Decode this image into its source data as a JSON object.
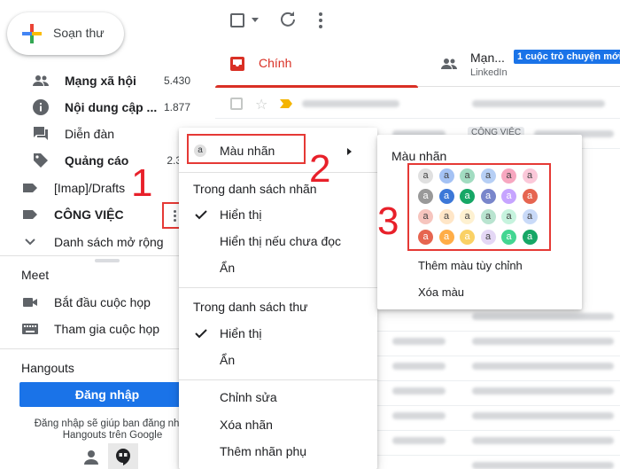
{
  "compose": {
    "label": "Soạn thư"
  },
  "sidebar": {
    "items": [
      {
        "label": "Mạng xã hội",
        "count": "5.430",
        "icon": "people-icon",
        "bold": true
      },
      {
        "label": "Nội dung cập ...",
        "count": "1.877",
        "icon": "info-icon",
        "bold": true
      },
      {
        "label": "Diễn đàn",
        "count": "",
        "icon": "forum-icon",
        "bold": false
      },
      {
        "label": "Quảng cáo",
        "count": "2.3",
        "icon": "tag-icon",
        "bold": true
      },
      {
        "label": "[Imap]/Drafts",
        "count": "",
        "icon": "label-icon",
        "bold": false
      },
      {
        "label": "CÔNG VIỆC",
        "count": "",
        "icon": "label-icon",
        "bold": true
      },
      {
        "label": "Danh sách mở rộng",
        "count": "",
        "icon": "chevron-down-icon",
        "bold": false
      }
    ],
    "meet": {
      "title": "Meet",
      "start": "Bắt đầu cuộc họp",
      "join": "Tham gia cuộc họp"
    },
    "hangouts": {
      "title": "Hangouts",
      "signin": "Đăng nhập",
      "hint": "Đăng nhập sẽ giúp ban đăng nhập Hangouts trên Google"
    }
  },
  "tabs": {
    "primary": "Chính",
    "social": "Mạn...",
    "social_sub": "LinkedIn",
    "social_badge": "1 cuộc trò chuyện mới"
  },
  "mail_rows": {
    "chip": "CÔNG VIỆC"
  },
  "context_menu": {
    "label_color": "Màu nhãn",
    "label_letter": "a",
    "section_label_list": "Trong danh sách nhãn",
    "show": "Hiển thị",
    "show_if_unread": "Hiển thị nếu chưa đọc",
    "hide": "Ẩn",
    "section_message_list": "Trong danh sách thư",
    "show2": "Hiển thị",
    "hide2": "Ẩn",
    "edit": "Chỉnh sửa",
    "remove_label": "Xóa nhãn",
    "add_sublabel": "Thêm nhãn phụ"
  },
  "color_menu": {
    "title": "Màu nhãn",
    "add_custom": "Thêm màu tùy chỉnh",
    "remove_color": "Xóa màu",
    "swatch_letter": "a",
    "swatches": [
      [
        "#e0e0e0",
        "#a4c2f4",
        "#a2dcc1",
        "#b6cff5",
        "#f7a7c0",
        "#fbc8d9"
      ],
      [
        "#999999",
        "#3c78d8",
        "#16a766",
        "#7986cb",
        "#c6a4ff",
        "#e66550"
      ],
      [
        "#f6c5be",
        "#ffe6c7",
        "#fef1d1",
        "#b9e4d0",
        "#c6f3de",
        "#c9daf8"
      ],
      [
        "#e66550",
        "#ffad47",
        "#fad165",
        "#e4d7f5",
        "#43d692",
        "#16a766"
      ]
    ],
    "swatch_text": [
      [
        "#444444",
        "#444444",
        "#444444",
        "#444444",
        "#444444",
        "#444444"
      ],
      [
        "#ffffff",
        "#ffffff",
        "#ffffff",
        "#ffffff",
        "#ffffff",
        "#ffffff"
      ],
      [
        "#444444",
        "#444444",
        "#444444",
        "#444444",
        "#444444",
        "#444444"
      ],
      [
        "#ffffff",
        "#ffffff",
        "#ffffff",
        "#444444",
        "#ffffff",
        "#ffffff"
      ]
    ]
  },
  "annotations": {
    "step1": "1",
    "step2": "2",
    "step3": "3"
  },
  "colors": {
    "accent_red": "#d93025",
    "blue": "#1a73e8",
    "marker_red": "#e8202a"
  }
}
